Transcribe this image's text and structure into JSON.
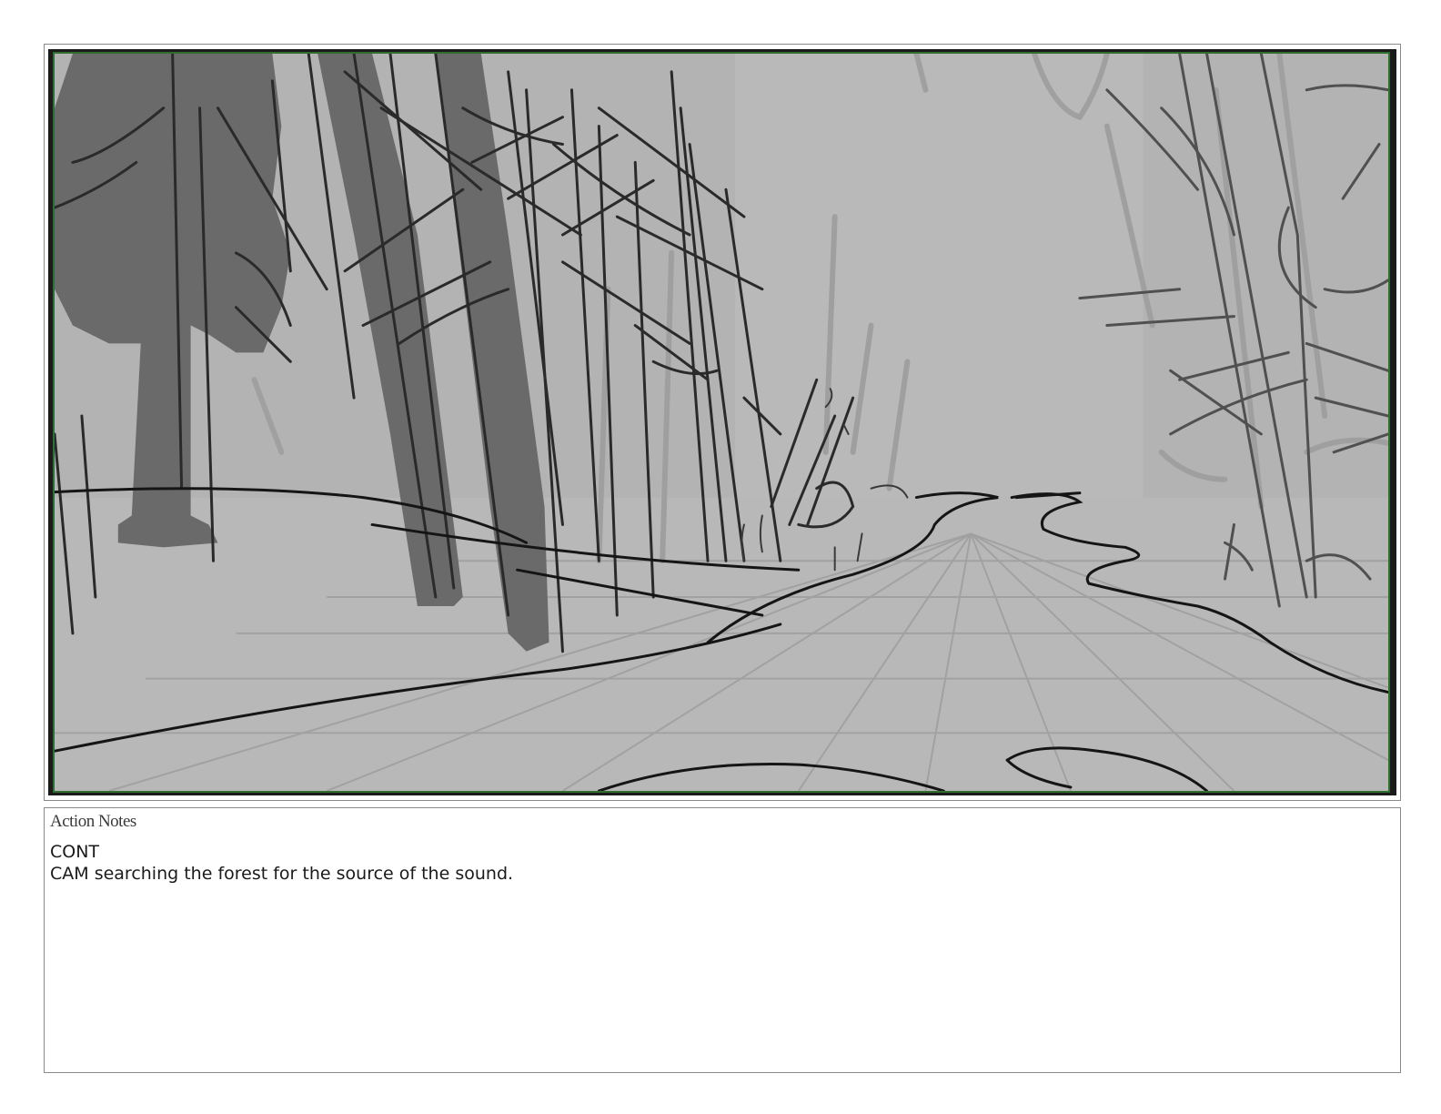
{
  "panel": {
    "image_description_icon": "storyboard-sketch-forest-path"
  },
  "action_notes": {
    "title": "Action Notes",
    "lines": [
      "CONT",
      "CAM searching the forest for the source of the sound."
    ]
  },
  "colors": {
    "frame_border": "#8a8a8a",
    "panel_inner_border": "#2f6e2f",
    "sketch_background": "#b4b4b4",
    "text": "#1a1a1a"
  }
}
